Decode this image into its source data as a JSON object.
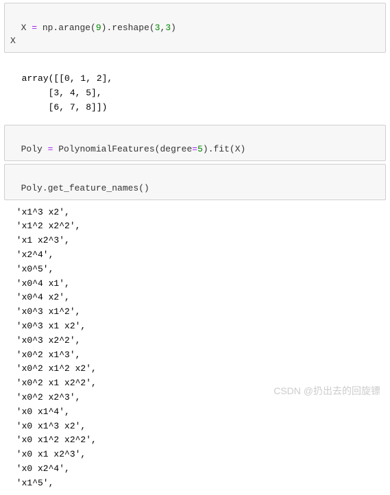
{
  "cell1": {
    "code_html": "X <span class='py-op'>=</span> np.arange(<span class='py-num'>9</span>).reshape(<span class='py-num'>3</span>,<span class='py-num'>3</span>)\nX"
  },
  "output1": {
    "text": "array([[0, 1, 2],\n       [3, 4, 5],\n       [6, 7, 8]])"
  },
  "cell2": {
    "code_html": "Poly <span class='py-op'>=</span> PolynomialFeatures(degree<span class='py-op'>=</span><span class='py-num'>5</span>).fit(X)"
  },
  "cell3": {
    "code_html": "Poly.get_feature_names()"
  },
  "output3": {
    "lines": [
      " 'x1^3 x2',",
      " 'x1^2 x2^2',",
      " 'x1 x2^3',",
      " 'x2^4',",
      " 'x0^5',",
      " 'x0^4 x1',",
      " 'x0^4 x2',",
      " 'x0^3 x1^2',",
      " 'x0^3 x1 x2',",
      " 'x0^3 x2^2',",
      " 'x0^2 x1^3',",
      " 'x0^2 x1^2 x2',",
      " 'x0^2 x1 x2^2',",
      " 'x0^2 x2^3',",
      " 'x0 x1^4',",
      " 'x0 x1^3 x2',",
      " 'x0 x1^2 x2^2',",
      " 'x0 x1 x2^3',",
      " 'x0 x2^4',",
      " 'x1^5',"
    ]
  },
  "watermark": "CSDN @扔出去的回旋镖"
}
